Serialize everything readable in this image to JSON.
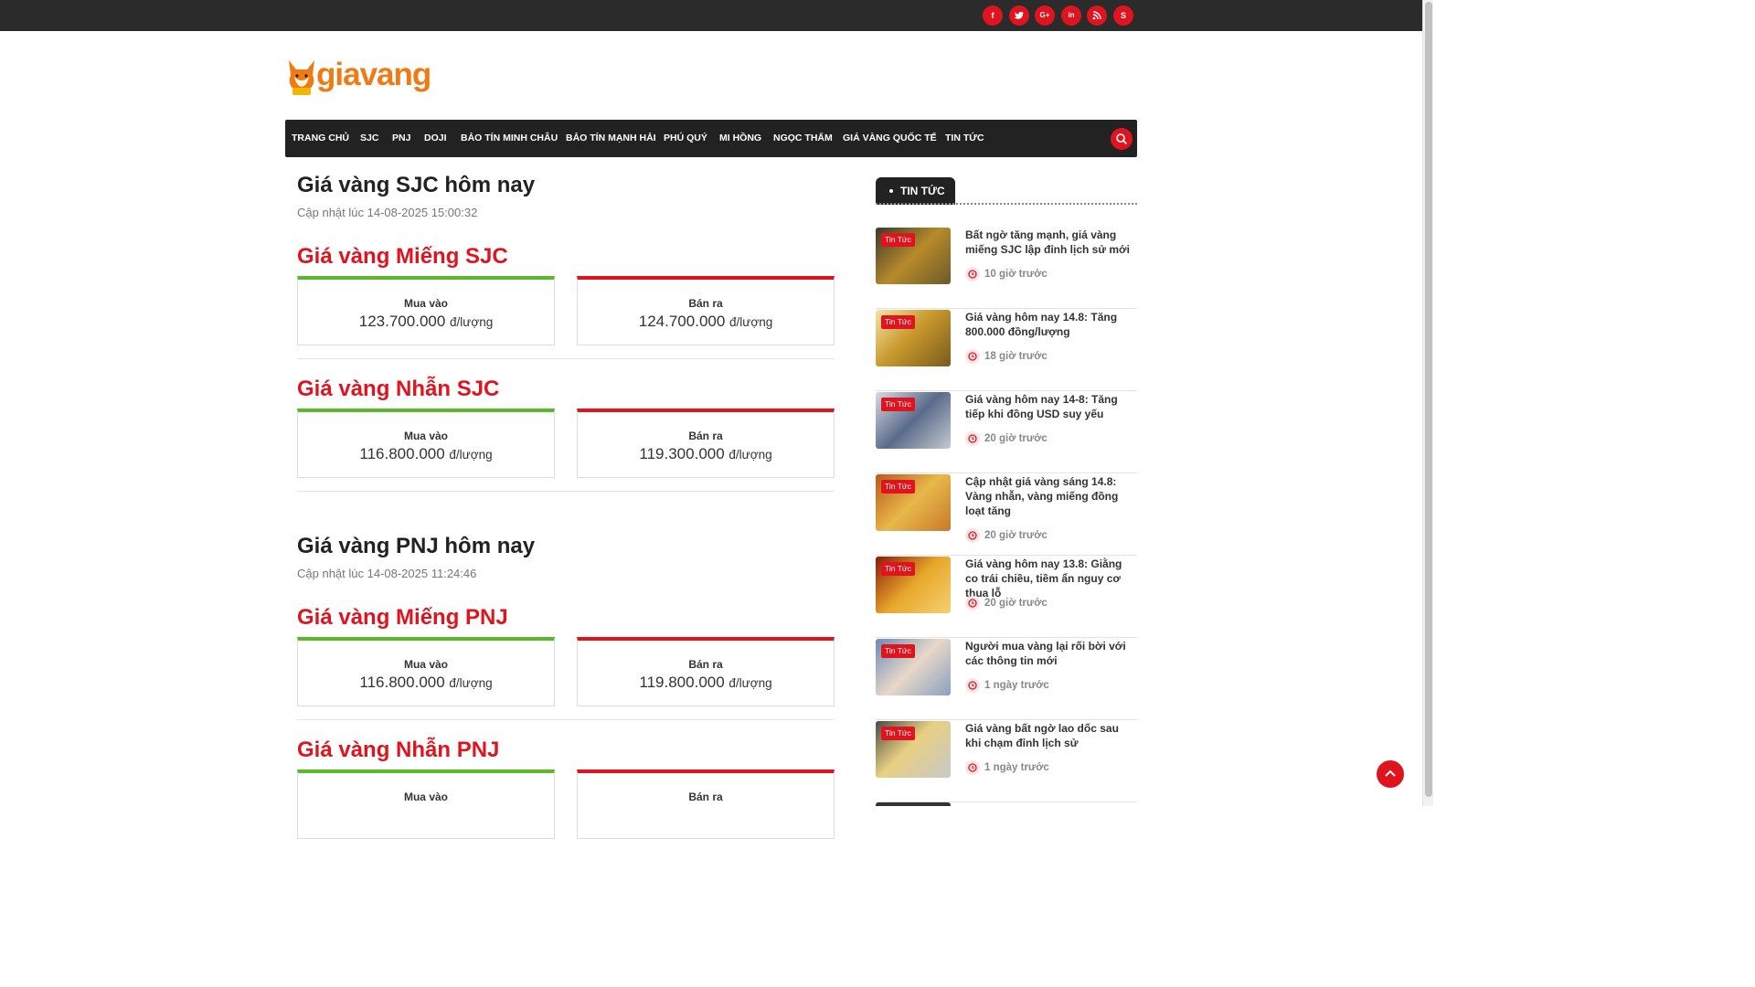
{
  "colors": {
    "accent": "#e0141e",
    "buy": "#5cb82b",
    "topbar": "#2b2b2b",
    "nav": "#222222",
    "brand": "#f07a14"
  },
  "social": [
    "facebook-icon",
    "twitter-icon",
    "google-plus-icon",
    "linkedin-icon",
    "rss-icon",
    "skype-icon"
  ],
  "logo": {
    "text": "giavang"
  },
  "nav": {
    "items": [
      "TRANG CHỦ",
      "SJC",
      "PNJ",
      "DOJI",
      "BẢO TÍN MINH CHÂU",
      "BẢO TÍN MẠNH HẢI",
      "PHÚ QUÝ",
      "MI HỒNG",
      "NGỌC THẨM",
      "GIÁ VÀNG QUỐC TẾ",
      "TIN TỨC"
    ]
  },
  "main": {
    "sjc": {
      "title": "Giá vàng SJC hôm nay",
      "updated": "Cập nhật lúc 14-08-2025 15:00:32",
      "mieng": {
        "title": "Giá vàng Miếng SJC",
        "buy_label": "Mua vào",
        "buy": "123.700.000",
        "sell_label": "Bán ra",
        "sell": "124.700.000",
        "unit": "đ/lượng"
      },
      "nhan": {
        "title": "Giá vàng Nhẫn SJC",
        "buy_label": "Mua vào",
        "buy": "116.800.000",
        "sell_label": "Bán ra",
        "sell": "119.300.000",
        "unit": "đ/lượng"
      }
    },
    "pnj": {
      "title": "Giá vàng PNJ hôm nay",
      "updated": "Cập nhật lúc 14-08-2025 11:24:46",
      "mieng": {
        "title": "Giá vàng Miếng PNJ",
        "buy_label": "Mua vào",
        "buy": "116.800.000",
        "sell_label": "Bán ra",
        "sell": "119.800.000",
        "unit": "đ/lượng"
      },
      "nhan": {
        "title": "Giá vàng Nhẫn PNJ",
        "buy_label": "Mua vào",
        "sell_label": "Bán ra"
      }
    }
  },
  "sidebar": {
    "tab": "TIN TỨC",
    "news": [
      {
        "badge": "Tin Tức",
        "title": "Bất ngờ tăng mạnh, giá vàng miếng SJC lập đỉnh lịch sử mới",
        "time": "10 giờ trước"
      },
      {
        "badge": "Tin Tức",
        "title": "Giá vàng hôm nay 14.8: Tăng 800.000 đồng/lượng",
        "time": "18 giờ trước"
      },
      {
        "badge": "Tin Tức",
        "title": "Giá vàng hôm nay 14-8: Tăng tiếp khi đồng USD suy yếu",
        "time": "20 giờ trước"
      },
      {
        "badge": "Tin Tức",
        "title": "Cập nhật giá vàng sáng 14.8: Vàng nhẫn, vàng miếng đồng loạt tăng",
        "time": "20 giờ trước"
      },
      {
        "badge": "Tin Tức",
        "title": "Giá vàng hôm nay 13.8: Giằng co trái chiều, tiềm ẩn nguy cơ thua lỗ",
        "time": "20 giờ trước"
      },
      {
        "badge": "Tin Tức",
        "title": "Người mua vàng lại rối bời với các thông tin mới",
        "time": "1 ngày trước"
      },
      {
        "badge": "Tin Tức",
        "title": "Giá vàng bất ngờ lao dốc sau khi chạm đỉnh lịch sử",
        "time": "1 ngày trước"
      }
    ]
  }
}
